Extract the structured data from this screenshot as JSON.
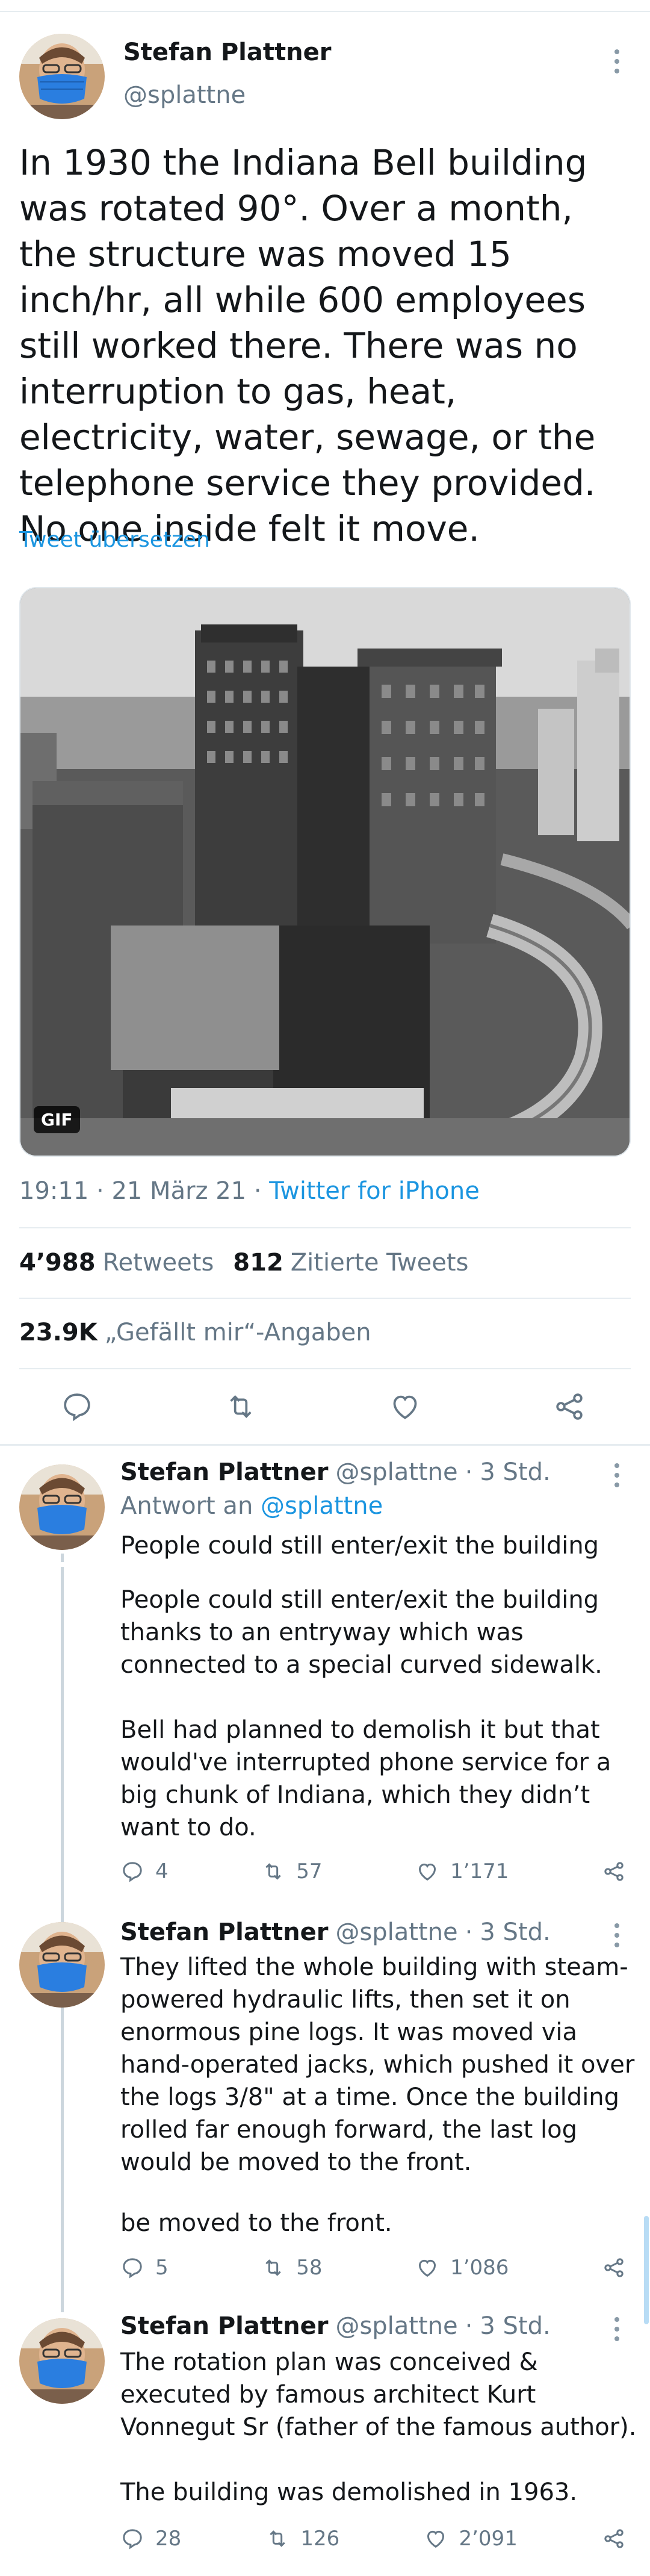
{
  "main_tweet": {
    "author_name": "Stefan Plattner",
    "author_handle": "@splattne",
    "text": "In 1930 the Indiana Bell building was rotated 90°. Over a month, the structure was moved 15 inch/hr, all while 600 employees still worked there. There was no interruption to gas, heat, electricity, water, sewage, or the telephone service they provided. No one inside felt it move.",
    "translate_link": "Tweet übersetzen",
    "media_badge": "GIF",
    "time": "19:11",
    "date": "21 März 21",
    "client": "Twitter for iPhone",
    "retweets_count": "4’988",
    "retweets_label": "Retweets",
    "quote_count": "812",
    "quote_label": "Zitierte Tweets",
    "likes_count": "23.9K",
    "likes_label": "„Gefällt mir“-Angaben"
  },
  "replies": [
    {
      "author_name": "Stefan Plattner",
      "author_handle": "@splattne",
      "age": "3 Std.",
      "reply_to_prefix": "Antwort an",
      "reply_to_handle": "@splattne",
      "preview_line": "People could still enter/exit the building",
      "text_p1": "People could still enter/exit the building thanks to an entryway which was connected to a special curved sidewalk.",
      "text_p2": "Bell had planned to demolish it but that would've interrupted phone service for a big chunk of Indiana, which they didn’t want to do.",
      "replies": "4",
      "retweets": "57",
      "likes": "1’171"
    },
    {
      "author_name": "Stefan Plattner",
      "author_handle": "@splattne",
      "age": "3 Std.",
      "text": "They lifted the whole building with steam-powered hydraulic lifts, then set it on enormous pine logs. It was moved via hand-operated jacks, which pushed it over the logs 3/8\" at a time. Once the building rolled far enough forward, the last log would be moved to the front.",
      "ghost_line": "be moved to the front.",
      "replies": "5",
      "retweets": "58",
      "likes": "1’086"
    },
    {
      "author_name": "Stefan Plattner",
      "author_handle": "@splattne",
      "age": "3 Std.",
      "text_p1": "The rotation plan was conceived & executed by famous architect Kurt Vonnegut Sr (father of the famous author).",
      "text_p2": "The building was demolished in 1963.",
      "replies": "28",
      "retweets": "126",
      "likes": "2’091"
    }
  ],
  "icons": [
    "avatar",
    "more-icon",
    "reply-icon",
    "retweet-icon",
    "like-icon",
    "share-icon"
  ],
  "colors": {
    "link": "#1b95e0",
    "meta": "#657786",
    "text": "#14171a",
    "divider": "#e6ecf0"
  }
}
